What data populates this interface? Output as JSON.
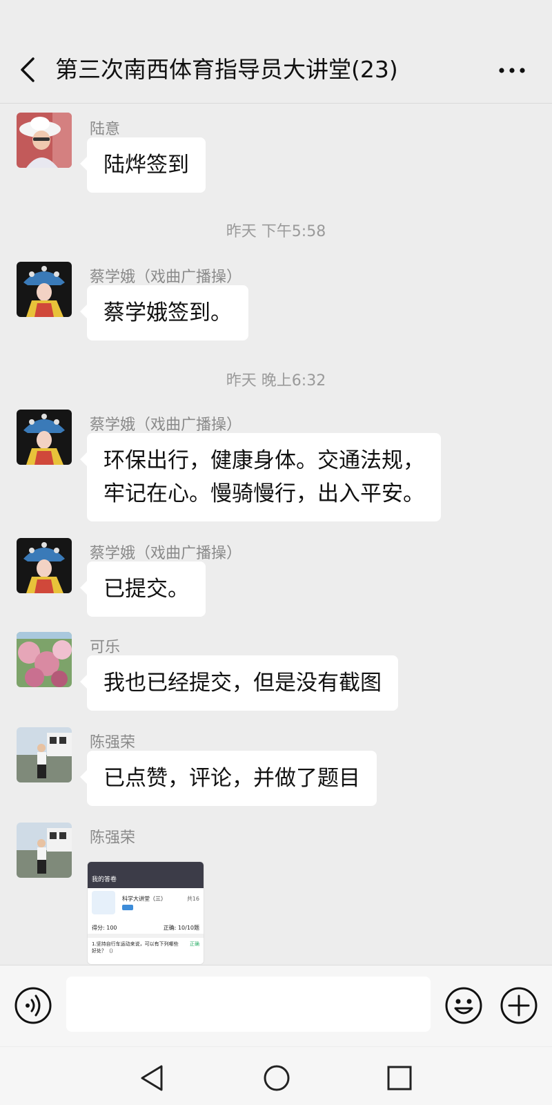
{
  "header": {
    "title": "第三次南西体育指导员大讲堂(23)",
    "back_icon": "chevron-left-icon",
    "more_icon": "more-dots-icon"
  },
  "messages": [
    {
      "sender": "陆意",
      "text": "陆烨签到"
    },
    {
      "time": "昨天 下午5:58"
    },
    {
      "sender": "蔡学娥（戏曲广播操）",
      "text": "蔡学娥签到。"
    },
    {
      "time": "昨天 晚上6:32"
    },
    {
      "sender": "蔡学娥（戏曲广播操）",
      "text_lines": [
        "环保出行，健康身体。交通法规，",
        "牢记在心。慢骑慢行，出入平安。"
      ]
    },
    {
      "sender": "蔡学娥（戏曲广播操）",
      "text": "已提交。"
    },
    {
      "sender": "可乐",
      "text": "我也已经提交，但是没有截图"
    },
    {
      "sender": "陈强荣",
      "text": "已点赞，评论，并做了题目"
    },
    {
      "sender": "陈强荣",
      "image": {
        "nav_title": "我的答卷",
        "card_title": "科学大讲堂（三）",
        "card_count": "共16",
        "score": "得分: 100",
        "correct": "正确: 10/10题",
        "question": "1.坚持自行车运动来说，可以有下列哪些好处？（）",
        "status": "正确"
      }
    }
  ],
  "input": {
    "placeholder": "",
    "voice_icon": "voice-icon",
    "emoji_icon": "emoji-icon",
    "plus_icon": "plus-circle-icon"
  },
  "system_nav": {
    "back_icon": "triangle-back-icon",
    "home_icon": "circle-home-icon",
    "recent_icon": "square-recent-icon"
  },
  "colors": {
    "background": "#ededed",
    "bubble": "#ffffff",
    "sender": "#8a8a8a",
    "time": "#9a9a9a"
  }
}
